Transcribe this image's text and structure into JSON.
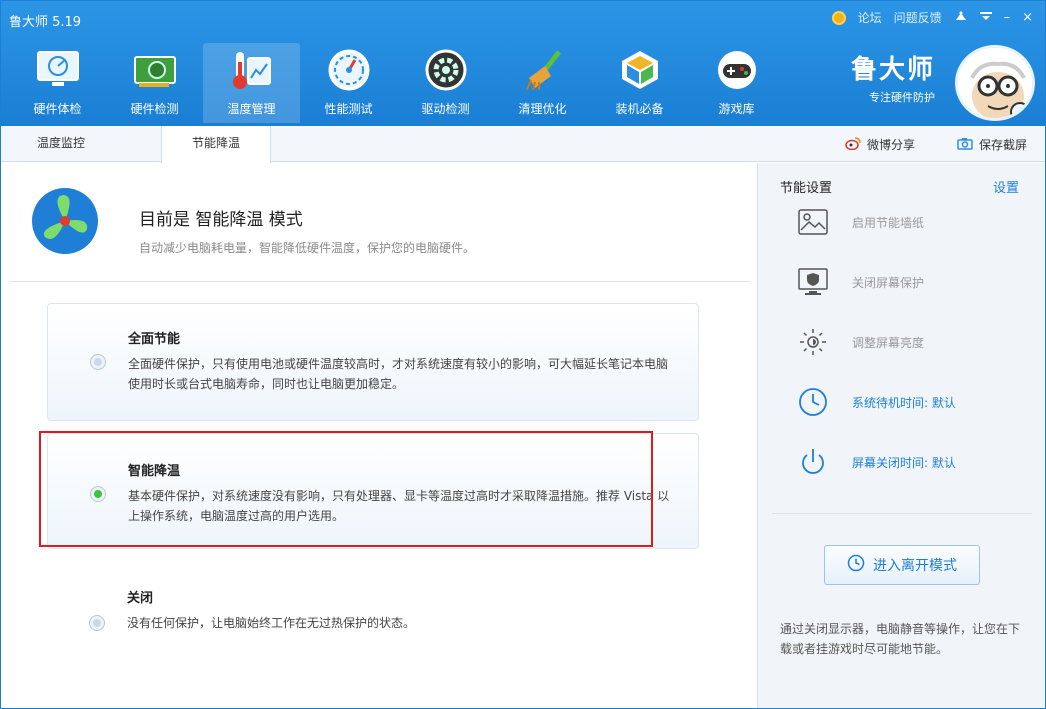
{
  "app": {
    "title": "鲁大师 5.19"
  },
  "topbar": {
    "forum": "论坛",
    "feedback": "问题反馈",
    "minimize": "–",
    "close": "×"
  },
  "nav": {
    "items": [
      {
        "label": "硬件体检"
      },
      {
        "label": "硬件检测"
      },
      {
        "label": "温度管理"
      },
      {
        "label": "性能测试"
      },
      {
        "label": "驱动检测"
      },
      {
        "label": "清理优化"
      },
      {
        "label": "装机必备"
      },
      {
        "label": "游戏库"
      }
    ]
  },
  "brand": {
    "name": "鲁大师",
    "slogan": "专注硬件防护"
  },
  "subtabs": {
    "monitor": "温度监控",
    "energy": "节能降温"
  },
  "actions": {
    "share": "微博分享",
    "screenshot": "保存截屏"
  },
  "mode": {
    "title": "目前是 智能降温 模式",
    "desc": "自动减少电脑耗电量，智能降低硬件温度，保护您的电脑硬件。"
  },
  "options": {
    "full": {
      "title": "全面节能",
      "desc": "全面硬件保护，只有使用电池或硬件温度较高时，才对系统速度有较小的影响，可大幅延长笔记本电脑使用时长或台式电脑寿命，同时也让电脑更加稳定。"
    },
    "smart": {
      "title": "智能降温",
      "desc": "基本硬件保护，对系统速度没有影响，只有处理器、显卡等温度过高时才采取降温措施。推荐 Vista 以上操作系统，电脑温度过高的用户选用。"
    },
    "off": {
      "title": "关闭",
      "desc": "没有任何保护，让电脑始终工作在无过热保护的状态。"
    }
  },
  "selected_option": "智能降温",
  "energy": {
    "title": "节能设置",
    "settings_link": "设置",
    "items": [
      {
        "label": "启用节能墙纸",
        "icon": "wallpaper-icon"
      },
      {
        "label": "关闭屏幕保护",
        "icon": "screensaver-icon"
      },
      {
        "label": "调整屏幕亮度",
        "icon": "brightness-icon"
      },
      {
        "label": "系统待机时间: 默认",
        "icon": "clock-icon"
      },
      {
        "label": "屏幕关闭时间: 默认",
        "icon": "power-icon"
      }
    ],
    "leave_button": "进入离开模式",
    "leave_desc": "通过关闭显示器，电脑静音等操作，让您在下载或者挂游戏时尽可能地节能。"
  },
  "colors": {
    "header": "#1a7fd4",
    "accent": "#1f7fd6",
    "highlight": "#e01b1b",
    "selected_radio": "#3cc43c"
  }
}
